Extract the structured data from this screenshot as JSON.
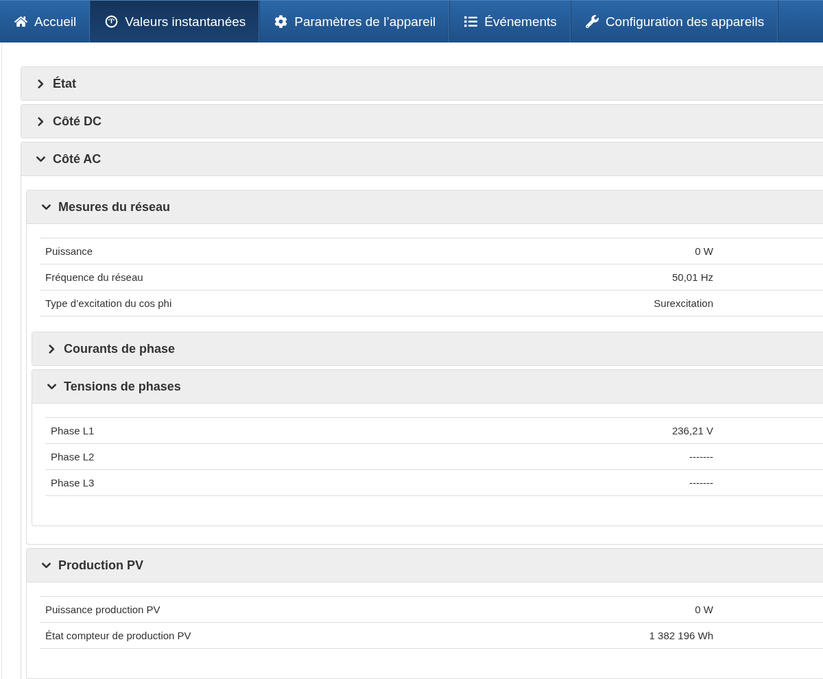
{
  "nav": {
    "tabs": [
      {
        "label": "Accueil",
        "selected": false
      },
      {
        "label": "Valeurs instantanées",
        "selected": true
      },
      {
        "label": "Paramètres de l’appareil",
        "selected": false
      },
      {
        "label": "Événements",
        "selected": false
      },
      {
        "label": "Configuration des appareils",
        "selected": false
      }
    ]
  },
  "panels": [
    {
      "title": "État",
      "expanded": false
    },
    {
      "title": "Côté DC",
      "expanded": false
    },
    {
      "title": "Côté AC",
      "expanded": true,
      "children": [
        {
          "title": "Mesures du réseau",
          "expanded": true,
          "rows": [
            {
              "label": "Puissance",
              "value": "0 W"
            },
            {
              "label": "Fréquence du réseau",
              "value": "50,01 Hz"
            },
            {
              "label": "Type d’excitation du cos phi",
              "value": "Surexcitation"
            }
          ],
          "children": [
            {
              "title": "Courants de phase",
              "expanded": false
            },
            {
              "title": "Tensions de phases",
              "expanded": true,
              "rows": [
                {
                  "label": "Phase L1",
                  "value": "236,21 V"
                },
                {
                  "label": "Phase L2",
                  "value": "-------"
                },
                {
                  "label": "Phase L3",
                  "value": "-------"
                }
              ]
            }
          ]
        },
        {
          "title": "Production PV",
          "expanded": true,
          "rows": [
            {
              "label": "Puissance production PV",
              "value": "0 W"
            },
            {
              "label": "État compteur de production PV",
              "value": "1 382 196 Wh"
            }
          ]
        }
      ]
    }
  ]
}
